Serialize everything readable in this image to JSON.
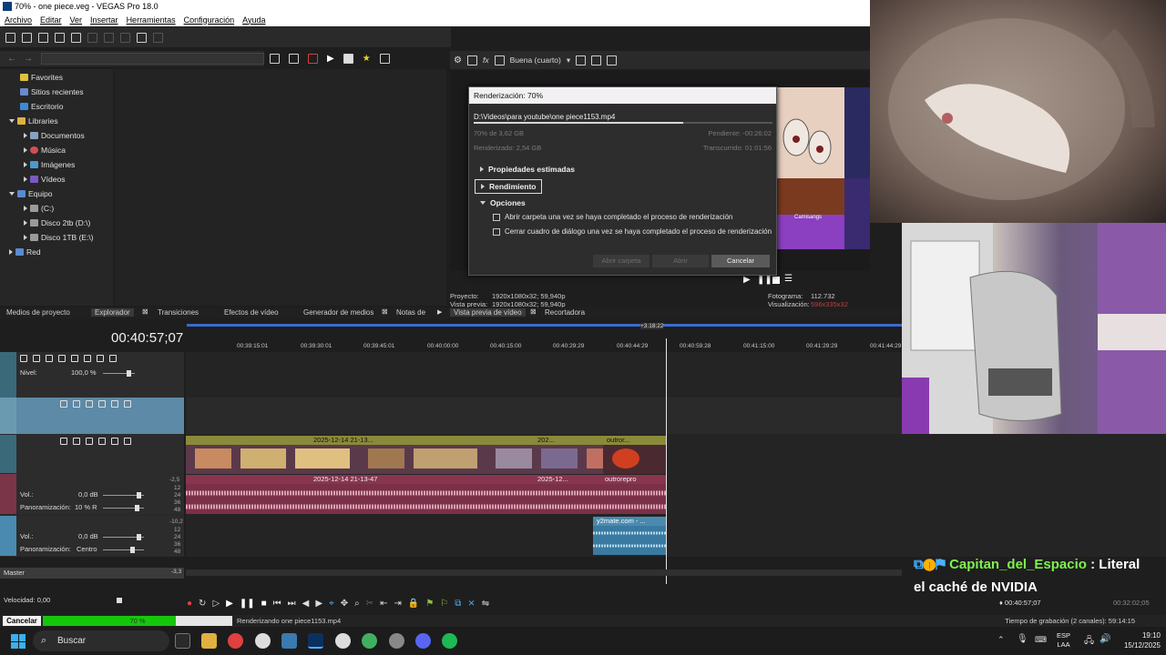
{
  "window": {
    "title": "70% - one piece.veg - VEGAS Pro 18.0"
  },
  "menu": [
    "Archivo",
    "Editar",
    "Ver",
    "Insertar",
    "Herramientas",
    "Configuración",
    "Ayuda"
  ],
  "explorer": {
    "tree": [
      {
        "label": "Favorites",
        "icon": "star-icon"
      },
      {
        "label": "Sitios recientes",
        "icon": "recent-icon"
      },
      {
        "label": "Escritorio",
        "icon": "desktop-icon"
      },
      {
        "label": "Libraries",
        "icon": "folder-icon"
      },
      {
        "label": "Documentos",
        "icon": "documents-icon"
      },
      {
        "label": "Música",
        "icon": "music-icon"
      },
      {
        "label": "Imágenes",
        "icon": "images-icon"
      },
      {
        "label": "Vídeos",
        "icon": "videos-icon"
      },
      {
        "label": "Equipo",
        "icon": "computer-icon"
      },
      {
        "label": "(C:)",
        "icon": "drive-icon"
      },
      {
        "label": "Disco 2tb (D:\\)",
        "icon": "drive-icon"
      },
      {
        "label": "Disco 1TB (E:\\)",
        "icon": "drive-icon"
      },
      {
        "label": "Red",
        "icon": "network-icon"
      }
    ]
  },
  "tabs": [
    "Medios de proyecto",
    "Explorador",
    "Transiciones",
    "Efectos de vídeo",
    "Generador de medios",
    "Notas de",
    "Vista previa de vídeo",
    "Recortadora"
  ],
  "preview": {
    "quality": "Buena (cuarto)",
    "proyecto_label": "Proyecto:",
    "proyecto_val": "1920x1080x32; 59,940p",
    "vista_label": "Vista previa:",
    "vista_val": "1920x1080x32; 59,940p",
    "fotograma_label": "Fotograma:",
    "fotograma_val": "112.732",
    "visual_label": "Visualización:",
    "visual_val": "596x335x32"
  },
  "render_dialog": {
    "title": "Renderización: 70%",
    "path": "D:\\Videos\\para youtube\\one piece1153.mp4",
    "progress": 0.7,
    "size_of": "70% de 3,62 GB",
    "rendered": "Renderizado: 2,54 GB",
    "pending": "Pendiente: -00:26:02",
    "elapsed": "Transcurrido: 01:01:56",
    "sections": [
      "Propiedades estimadas",
      "Rendimiento",
      "Opciones"
    ],
    "options": [
      "Abrir carpeta una vez se haya completado el proceso de renderización",
      "Cerrar cuadro de diálogo una vez se haya completado el proceso de renderización"
    ],
    "buttons": {
      "open_folder": "Abrir carpeta",
      "open": "Abrir",
      "cancel": "Cancelar"
    }
  },
  "timeline": {
    "timecode": "00:40:57;07",
    "marker_label": "+3:18:22",
    "ruler": [
      "00:39:15:01",
      "00:39:30:01",
      "00:39:45:01",
      "00:40:00:00",
      "00:40:15:00",
      "00:40:29:29",
      "00:40:44:29",
      "00:40:59:28",
      "00:41:15:00",
      "00:41:29:29",
      "00:41:44:29"
    ],
    "tracks": {
      "t1": {
        "nivel_label": "Nivel:",
        "nivel_val": "100,0 %"
      },
      "t4": {
        "vol_label": "Vol.:",
        "vol_val": "0,0 dB",
        "pan_label": "Panoramización:",
        "pan_val": "10 % R"
      },
      "t5": {
        "vol_label": "Vol.:",
        "vol_val": "0,0 dB",
        "pan_label": "Panoramización:",
        "pan_val": "Centro"
      }
    },
    "meter_labels": [
      "-2,5",
      "12",
      "24",
      "36",
      "48"
    ],
    "meter_labels2": [
      "-10,2",
      "12",
      "24",
      "36",
      "48"
    ],
    "clips": {
      "video1": "2025-12-14 21-13...",
      "video2": "202...",
      "video3": "outror...",
      "audio1": "2025-12-14 21-13-47",
      "audio2": "2025-12...",
      "audio3": "outrorepro",
      "audio4": "y2mate.com - ..."
    },
    "master": "Master",
    "master_db": "-3,3",
    "velocidad": "Velocidad: 0,00",
    "right_time": "00:40:57;07",
    "right_time2": "00:32:02;05"
  },
  "statusbar": {
    "cancel": "Cancelar",
    "progress": 0.7,
    "progress_label": "70 %",
    "status": "Renderizando one piece1153.mp4",
    "rec_time": "Tiempo de grabación (2 canales): 59:14:15"
  },
  "chat": {
    "user": "Capitan_del_Espacio",
    "separator": " : ",
    "line1": "Literal",
    "line2": "el caché de NVIDIA"
  },
  "preview_overlay_text": "Camisangs",
  "taskbar": {
    "search": "Buscar",
    "lang1": "ESP",
    "lang2": "LAA",
    "time": "19:10",
    "date": "15/12/2025"
  },
  "colors": {
    "video_clip": "#8a8a3a",
    "audio_clip": "#8a3550",
    "audio2_clip": "#4a8ab0",
    "render_fill": "#16c60c",
    "chat_user": "#7ff04e"
  }
}
